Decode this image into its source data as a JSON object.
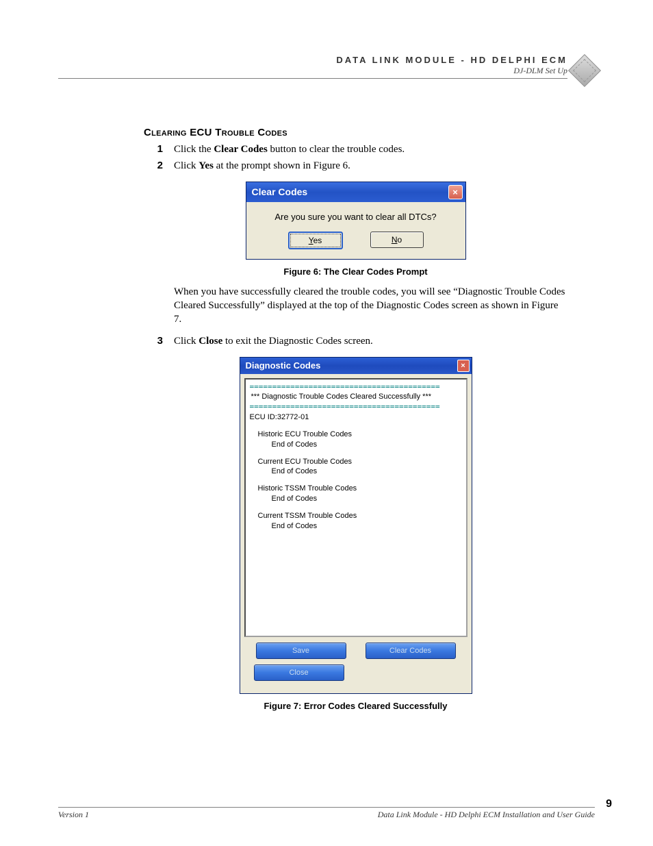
{
  "header": {
    "title": "DATA LINK MODULE - HD DELPHI ECM",
    "subtitle": "DJ-DLM Set Up"
  },
  "section_title": "Clearing ECU Trouble Codes",
  "steps": [
    {
      "num": "1",
      "pre": "Click the ",
      "bold": "Clear Codes",
      "post": " button to clear the trouble codes."
    },
    {
      "num": "2",
      "pre": "Click ",
      "bold": "Yes",
      "post": " at the prompt shown in Figure 6."
    }
  ],
  "dialog1": {
    "title": "Clear Codes",
    "message": "Are you sure you want to clear all DTCs?",
    "yes_u": "Y",
    "yes_rest": "es",
    "no_u": "N",
    "no_rest": "o"
  },
  "fig6_caption": "Figure 6: The Clear Codes Prompt",
  "para1": "When you have successfully cleared the trouble codes, you will see “Diagnostic Trouble Codes Cleared Successfully” displayed at the top of the Diagnostic Codes screen as shown in Figure 7.",
  "step3": {
    "num": "3",
    "pre": "Click ",
    "bold": "Close",
    "post": " to exit the Diagnostic Codes screen."
  },
  "dialog2": {
    "title": "Diagnostic Codes",
    "hr": "==========================================",
    "success_msg": "*** Diagnostic Trouble Codes Cleared Successfully ***",
    "ecu_id": "ECU ID:32772-01",
    "blocks": [
      {
        "title": "Historic ECU Trouble Codes",
        "end": "End of Codes"
      },
      {
        "title": "Current ECU Trouble Codes",
        "end": "End of Codes"
      },
      {
        "title": "Historic TSSM Trouble Codes",
        "end": "End of Codes"
      },
      {
        "title": "Current TSSM Trouble Codes",
        "end": "End of Codes"
      }
    ],
    "buttons": {
      "save": "Save",
      "clear": "Clear Codes",
      "close": "Close"
    }
  },
  "fig7_caption": "Figure 7: Error Codes Cleared Successfully",
  "footer": {
    "left": "Version 1",
    "right": "Data Link Module - HD Delphi ECM Installation and User Guide",
    "page": "9"
  }
}
